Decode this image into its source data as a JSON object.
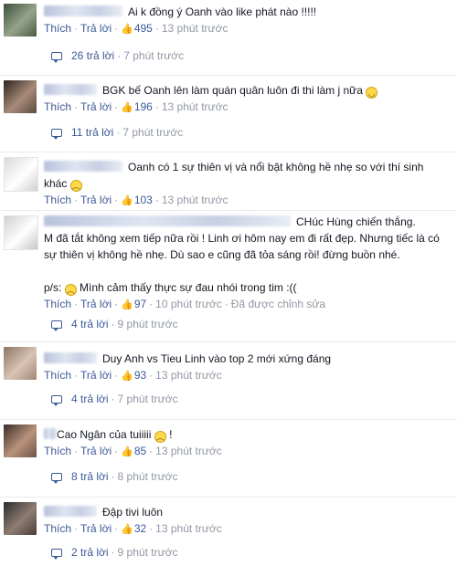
{
  "labels": {
    "like": "Thích",
    "reply": "Trả lời",
    "edited": "Đã được chỉnh sửa"
  },
  "comments": [
    {
      "text": "Ai k đồng ý Oanh vào like phát nào !!!!!",
      "likes": "495",
      "time": "13 phút trước",
      "replies": "26 trả lời",
      "replies_time": "7 phút trước"
    },
    {
      "text": "BGK bế Oanh lên làm quán quân luôn đi thi làm j nữa",
      "emoji": "smirk",
      "likes": "196",
      "time": "13 phút trước",
      "replies": "11 trả lời",
      "replies_time": "7 phút trước"
    },
    {
      "text": "Oanh có 1 sự thiên vị và nổi bật không hề nhẹ so với thí sinh",
      "text2": "khác",
      "emoji": "frown",
      "likes": "103",
      "time": "13 phút trước"
    },
    {
      "text": "CHúc Hùng chiến thắng.",
      "text2": "M đã tắt không xem tiếp nữa rồi ! Linh ơi hôm nay em đi rất đẹp. Nhưng tiếc là có sự thiên vị không hề nhẹ. Dù sao e cũng đã tỏa sáng rồi! đừng buồn nhé.",
      "text3_prefix": "p/s:",
      "text3": "Mình cảm thấy thực sự đau nhói trong tim :((",
      "emoji": "frown",
      "likes": "97",
      "time": "10 phút trước",
      "replies": "4 trả lời",
      "replies_time": "9 phút trước"
    },
    {
      "text": "Duy Anh vs Tieu Linh vào top 2 mới xứng đáng",
      "likes": "93",
      "time": "13 phút trước",
      "replies": "4 trả lời",
      "replies_time": "7 phút trước"
    },
    {
      "text": "Cao Ngân của tuiiiii",
      "text_suffix": "!",
      "emoji": "frown",
      "likes": "85",
      "time": "13 phút trước",
      "replies": "8 trả lời",
      "replies_time": "8 phút trước"
    },
    {
      "text": "Đập tivi luôn",
      "likes": "32",
      "time": "13 phút trước",
      "replies": "2 trả lời",
      "replies_time": "9 phút trước"
    }
  ],
  "icons": {
    "like": "thumbs-up-icon",
    "reply": "reply-bubble-icon",
    "emoji_smirk": "smirk-emoji-icon",
    "emoji_frown": "frown-emoji-icon"
  },
  "colors": {
    "link": "#3b5998",
    "meta": "#9197a3",
    "text": "#141823"
  }
}
